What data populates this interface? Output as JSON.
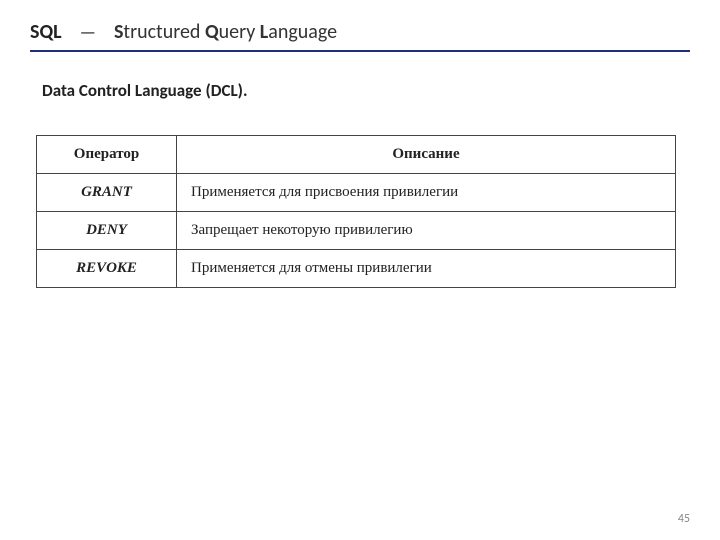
{
  "header": {
    "sql": "SQL",
    "dash": "—",
    "title_parts": {
      "s": "S",
      "tructured": "tructured ",
      "q": "Q",
      "uery": "uery ",
      "l": "L",
      "anguage": "anguage"
    }
  },
  "section_title": "Data Control Language (DCL).",
  "table": {
    "headers": {
      "operator": "Оператор",
      "description": "Описание"
    },
    "rows": [
      {
        "op": "GRANT",
        "desc": "Применяется для присвоения привилегии"
      },
      {
        "op": "DENY",
        "desc": "Запрещает некоторую привилегию"
      },
      {
        "op": "REVOKE",
        "desc": "Применяется для отмены привилегии"
      }
    ]
  },
  "page_number": "45"
}
